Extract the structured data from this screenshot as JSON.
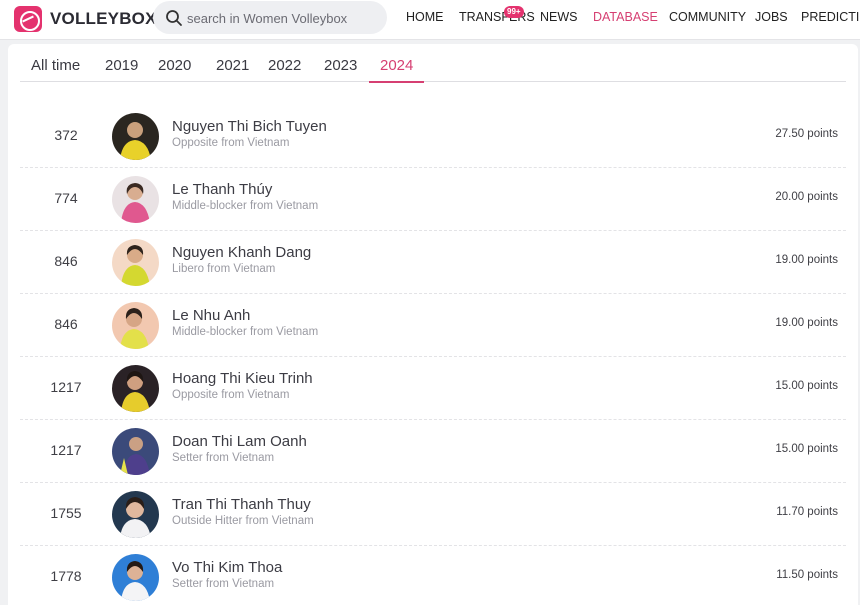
{
  "header": {
    "brand": "VOLLEYBOX",
    "search_placeholder": "search in Women Volleybox",
    "nav": [
      {
        "label": "HOME"
      },
      {
        "label": "TRANSFERS"
      },
      {
        "label": "NEWS"
      },
      {
        "label": "DATABASE"
      },
      {
        "label": "COMMUNITY"
      },
      {
        "label": "JOBS"
      },
      {
        "label": "PREDICTION"
      }
    ],
    "transfers_badge": "99+",
    "active_nav": "DATABASE",
    "accent_color": "#d63f72"
  },
  "tabs": [
    {
      "label": "All time"
    },
    {
      "label": "2019"
    },
    {
      "label": "2020"
    },
    {
      "label": "2021"
    },
    {
      "label": "2022"
    },
    {
      "label": "2023"
    },
    {
      "label": "2024"
    }
  ],
  "active_tab": "2024",
  "players": [
    {
      "rank": "372",
      "name": "Nguyen Thi Bich Tuyen",
      "info": "Opposite from Vietnam",
      "points": "27.50 points"
    },
    {
      "rank": "774",
      "name": "Le Thanh Thúy",
      "info": "Middle-blocker from Vietnam",
      "points": "20.00 points"
    },
    {
      "rank": "846",
      "name": "Nguyen Khanh Dang",
      "info": "Libero from Vietnam",
      "points": "19.00 points"
    },
    {
      "rank": "846",
      "name": "Le Nhu Anh",
      "info": "Middle-blocker from Vietnam",
      "points": "19.00 points"
    },
    {
      "rank": "1217",
      "name": "Hoang Thi Kieu Trinh",
      "info": "Opposite from Vietnam",
      "points": "15.00 points"
    },
    {
      "rank": "1217",
      "name": "Doan Thi Lam Oanh",
      "info": "Setter from Vietnam",
      "points": "15.00 points"
    },
    {
      "rank": "1755",
      "name": "Tran Thi Thanh Thuy",
      "info": "Outside Hitter from Vietnam",
      "points": "11.70 points"
    },
    {
      "rank": "1778",
      "name": "Vo Thi Kim Thoa",
      "info": "Setter from Vietnam",
      "points": "11.50 points"
    }
  ]
}
